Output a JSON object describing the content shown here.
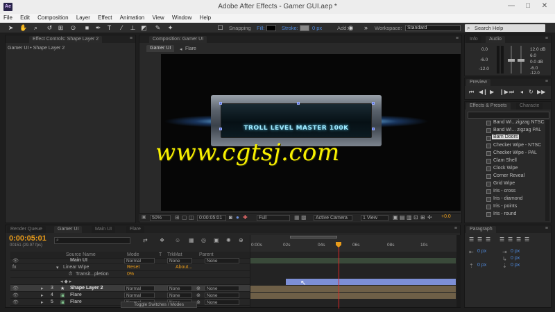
{
  "window": {
    "app_logo": "Ae",
    "title": "Adobe After Effects - Gamer GUI.aep *",
    "minimize": "—",
    "maximize": "□",
    "close": "✕"
  },
  "menu": [
    "File",
    "Edit",
    "Composition",
    "Layer",
    "Effect",
    "Animation",
    "View",
    "Window",
    "Help"
  ],
  "toolbar": {
    "snapping": "Snapping",
    "fill": "Fill:",
    "stroke": "Stroke:",
    "stroke_value": "0 px",
    "add": "Add:",
    "workspace_label": "Workspace:",
    "workspace_value": "Standard",
    "search_placeholder": "Search Help"
  },
  "effect_controls": {
    "tab": "Effect Controls: Shape Layer 2",
    "breadcrumb": "Gamer UI • Shape Layer 2"
  },
  "composition": {
    "tab": "Composition: Gamer UI",
    "nav_comp": "Gamer UI",
    "nav_layer": "Flare",
    "hud_text": "TROLL LEVEL MASTER 100K",
    "zoom": "50%",
    "timecode": "0:00:05:01",
    "resolution": "Full",
    "camera": "Active Camera",
    "view": "1 View",
    "exposure": "+0.0"
  },
  "watermark": "www.cgtsj.com",
  "info_panel": {
    "tab_info": "Info",
    "tab_audio": "Audio",
    "levels_left": [
      "0.0",
      "-6.0",
      "-12.0"
    ],
    "levels_right": [
      "12.0 dB",
      "6.0",
      "0.0 dB",
      "-6.0",
      "-12.0"
    ]
  },
  "preview_panel": {
    "tab": "Preview"
  },
  "effects_panel": {
    "tab_effects": "Effects & Presets",
    "tab_character": "Characte",
    "items": [
      "Band Wi...zigzag NTSC",
      "Band Wi... zigzag PAL",
      "Barn Doors",
      "Checker Wipe - NTSC",
      "Checker Wipe - PAL",
      "Clam Shell",
      "Clock Wipe",
      "Corner Reveal",
      "Grid Wipe",
      "Iris - cross",
      "Iris - diamond",
      "Iris - points",
      "Iris - round"
    ]
  },
  "paragraph_panel": {
    "tab": "Paragraph",
    "indent_values": [
      "0 px",
      "0 px",
      "0 px",
      "0 px",
      "0 px"
    ]
  },
  "timeline": {
    "tab_render": "Render Queue",
    "tab_gamer": "Gamer UI",
    "tab_main": "Main UI",
    "tab_flare": "Flare",
    "timecode": "0:00:05:01",
    "frame_info": "00151 (29.97 fps)",
    "search_placeholder": "",
    "columns": {
      "source_name": "Source Name",
      "mode": "Mode",
      "t": "T",
      "trkmat": "TrkMat",
      "parent": "Parent"
    },
    "ruler": [
      "0:00s",
      "02s",
      "04s",
      "06s",
      "08s",
      "10s"
    ],
    "rows": [
      {
        "num": "",
        "name": "Main UI",
        "mode": "Normal",
        "trkmat": "None",
        "parent": "None"
      },
      {
        "num": "",
        "name": "Linear Wipe",
        "reset": "Reset",
        "about": "About..."
      },
      {
        "num": "",
        "name": "Transit...pletion",
        "value": "0%"
      },
      {
        "num": "3",
        "name": "Shape Layer 2",
        "mode": "Normal",
        "trkmat": "None",
        "parent": "None"
      },
      {
        "num": "4",
        "name": "Flare",
        "mode": "Normal",
        "trkmat": "None",
        "parent": "None"
      },
      {
        "num": "5",
        "name": "Flare",
        "mode": "Normal",
        "trkmat": "None",
        "parent": "None"
      }
    ],
    "toggle_label": "Toggle Switches / Modes"
  },
  "colors": {
    "accent_orange": "#e89b1a",
    "layer_bar_blue": "#7d8fd6",
    "layer_bar_tan": "#6e5f47",
    "playhead_red": "#e02626",
    "watermark_yellow": "#f7f000"
  }
}
